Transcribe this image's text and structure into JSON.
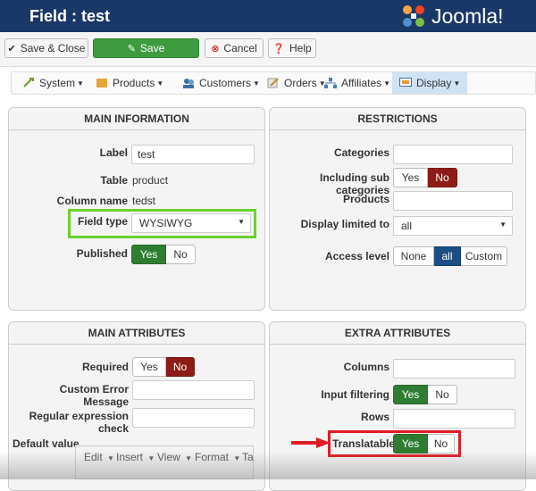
{
  "header": {
    "title": "Field : test",
    "logo_text": "Joomla!"
  },
  "toolbar": {
    "save_close": "Save & Close",
    "save": "Save",
    "cancel": "Cancel",
    "help": "Help"
  },
  "menu": {
    "items": [
      {
        "label": "System",
        "icon": "wrench-icon"
      },
      {
        "label": "Products",
        "icon": "box-icon"
      },
      {
        "label": "Customers",
        "icon": "users-icon"
      },
      {
        "label": "Orders",
        "icon": "pencil-icon"
      },
      {
        "label": "Affiliates",
        "icon": "sitemap-icon"
      },
      {
        "label": "Display",
        "icon": "monitor-icon",
        "active": true
      }
    ]
  },
  "main_info": {
    "heading": "MAIN INFORMATION",
    "label_label": "Label",
    "label_value": "test",
    "table_label": "Table",
    "table_value": "product",
    "column_label": "Column name",
    "column_value": "tedst",
    "fieldtype_label": "Field type",
    "fieldtype_value": "WYSIWYG",
    "published_label": "Published",
    "yes": "Yes",
    "no": "No"
  },
  "restrictions": {
    "heading": "RESTRICTIONS",
    "categories_label": "Categories",
    "subcat_label": "Including sub categories",
    "yes": "Yes",
    "no": "No",
    "products_label": "Products",
    "display_label": "Display limited to",
    "display_value": "all",
    "access_label": "Access level",
    "access_none": "None",
    "access_all": "all",
    "access_custom": "Custom"
  },
  "main_attributes": {
    "heading": "MAIN ATTRIBUTES",
    "required_label": "Required",
    "yes": "Yes",
    "no": "No",
    "error_label": "Custom Error Message",
    "regex_label": "Regular expression check",
    "default_label": "Default value",
    "editor_menu": [
      "Edit",
      "Insert",
      "View",
      "Format",
      "Ta"
    ]
  },
  "extra_attributes": {
    "heading": "EXTRA ATTRIBUTES",
    "columns_label": "Columns",
    "filter_label": "Input filtering",
    "yes": "Yes",
    "no": "No",
    "rows_label": "Rows",
    "translatable_label": "Translatable"
  },
  "colors": {
    "header_bg": "#1a3867",
    "green": "#2f7d32",
    "red": "#8e1c16",
    "blue": "#1d4e85",
    "highlight_green": "#6bd12f",
    "highlight_red": "#e01b24"
  }
}
